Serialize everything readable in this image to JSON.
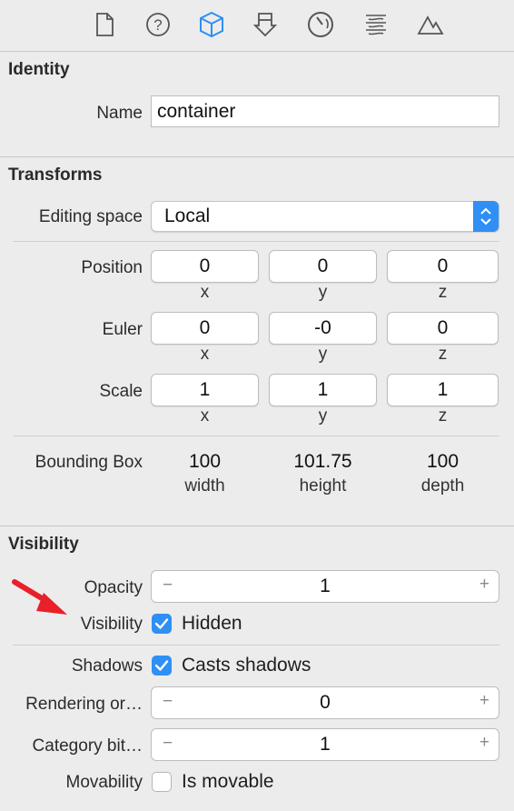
{
  "toolbar": {
    "icons": [
      "file-icon",
      "help-icon",
      "cube-icon",
      "attributes-icon",
      "physics-icon",
      "materials-icon",
      "scene-icon"
    ]
  },
  "identity": {
    "title": "Identity",
    "name_label": "Name",
    "name_value": "container"
  },
  "transforms": {
    "title": "Transforms",
    "editing_space_label": "Editing space",
    "editing_space_value": "Local",
    "position_label": "Position",
    "position": [
      "0",
      "0",
      "0"
    ],
    "euler_label": "Euler",
    "euler": [
      "0",
      "-0",
      "0"
    ],
    "scale_label": "Scale",
    "scale": [
      "1",
      "1",
      "1"
    ],
    "axis_labels": [
      "x",
      "y",
      "z"
    ],
    "bounding_box_label": "Bounding Box",
    "bounding_box_values": [
      "100",
      "101.75",
      "100"
    ],
    "bounding_box_dims": [
      "width",
      "height",
      "depth"
    ]
  },
  "visibility": {
    "title": "Visibility",
    "opacity_label": "Opacity",
    "opacity_value": "1",
    "visibility_label": "Visibility",
    "hidden_label": "Hidden",
    "hidden_checked": true,
    "shadows_label": "Shadows",
    "casts_shadows_label": "Casts shadows",
    "casts_shadows_checked": true,
    "rendering_order_label": "Rendering or…",
    "rendering_order_value": "0",
    "category_bit_label": "Category bit…",
    "category_bit_value": "1",
    "movability_label": "Movability",
    "is_movable_label": "Is movable",
    "is_movable_checked": false,
    "stepper_minus": "−",
    "stepper_plus": "+"
  },
  "colors": {
    "accent": "#2f8ff5",
    "annotation_arrow": "#e8202a",
    "panel_bg": "#ececec"
  }
}
